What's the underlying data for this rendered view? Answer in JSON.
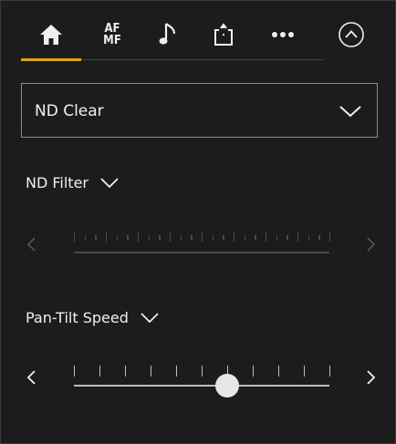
{
  "tabs": [
    {
      "icon": "home-icon",
      "label": ""
    },
    {
      "icon": "af-mf-icon",
      "label_top": "AF",
      "label_bottom": "MF"
    },
    {
      "icon": "music-note-icon",
      "label": ""
    },
    {
      "icon": "export-icon",
      "label": ""
    },
    {
      "icon": "more-icon",
      "label": ""
    },
    {
      "icon": "collapse-up-icon",
      "label": ""
    }
  ],
  "dropdown": {
    "value": "ND Clear"
  },
  "nd_filter": {
    "label": "ND Filter",
    "enabled": false
  },
  "pan_tilt": {
    "label": "Pan-Tilt Speed",
    "enabled": true,
    "level": 0.6
  },
  "colors": {
    "accent": "#e0a020",
    "background": "#1c1c1c",
    "text": "#f0f0f0"
  }
}
